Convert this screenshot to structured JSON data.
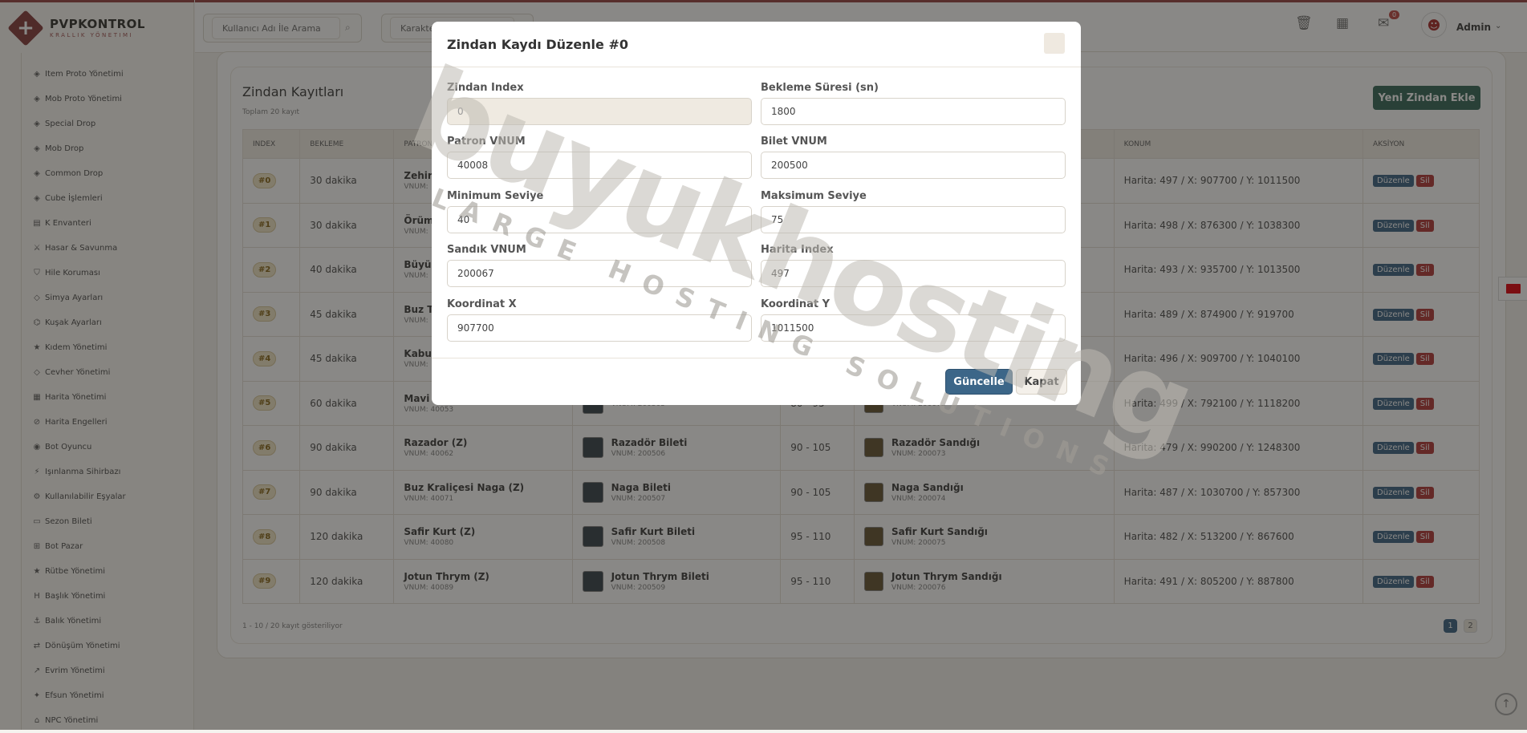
{
  "brand": {
    "title": "PVPKONTROL",
    "subtitle": "KRALLIK YÖNETIMI"
  },
  "sidebar": {
    "items": [
      {
        "icon": "box-icon",
        "glyph": "◈",
        "label": "Item Proto Yönetimi"
      },
      {
        "icon": "monster-icon",
        "glyph": "◈",
        "label": "Mob Proto Yönetimi"
      },
      {
        "icon": "gift-icon",
        "glyph": "◈",
        "label": "Special Drop"
      },
      {
        "icon": "skull-icon",
        "glyph": "◈",
        "label": "Mob Drop"
      },
      {
        "icon": "chest-icon",
        "glyph": "◈",
        "label": "Common Drop"
      },
      {
        "icon": "cube-icon",
        "glyph": "◈",
        "label": "Cube İşlemleri"
      },
      {
        "icon": "inventory-icon",
        "glyph": "▤",
        "label": "K Envanteri"
      },
      {
        "icon": "sword-icon",
        "glyph": "⚔",
        "label": "Hasar & Savunma"
      },
      {
        "icon": "shield-icon",
        "glyph": "⛉",
        "label": "Hile Koruması"
      },
      {
        "icon": "gem-icon",
        "glyph": "◇",
        "label": "Simya Ayarları"
      },
      {
        "icon": "belt-icon",
        "glyph": "⌬",
        "label": "Kuşak Ayarları"
      },
      {
        "icon": "star-icon",
        "glyph": "★",
        "label": "Kıdem Yönetimi"
      },
      {
        "icon": "diamond-icon",
        "glyph": "◇",
        "label": "Cevher Yönetimi"
      },
      {
        "icon": "map-icon",
        "glyph": "▦",
        "label": "Harita Yönetimi"
      },
      {
        "icon": "ban-icon",
        "glyph": "⊘",
        "label": "Harita Engelleri"
      },
      {
        "icon": "robot-icon",
        "glyph": "◉",
        "label": "Bot Oyuncu"
      },
      {
        "icon": "wand-icon",
        "glyph": "⚡",
        "label": "Işınlanma Sihirbazı"
      },
      {
        "icon": "gears-icon",
        "glyph": "⚙",
        "label": "Kullanılabilir Eşyalar"
      },
      {
        "icon": "ticket-icon",
        "glyph": "▭",
        "label": "Sezon Bileti"
      },
      {
        "icon": "cart-icon",
        "glyph": "⊞",
        "label": "Bot Pazar"
      },
      {
        "icon": "rank-star-icon",
        "glyph": "★",
        "label": "Rütbe Yönetimi"
      },
      {
        "icon": "heading-icon",
        "glyph": "H",
        "label": "Başlık Yönetimi"
      },
      {
        "icon": "anchor-icon",
        "glyph": "⚓",
        "label": "Balık Yönetimi"
      },
      {
        "icon": "shuffle-icon",
        "glyph": "⇄",
        "label": "Dönüşüm Yönetimi"
      },
      {
        "icon": "evolve-icon",
        "glyph": "↗",
        "label": "Evrim Yönetimi"
      },
      {
        "icon": "magic-icon",
        "glyph": "✦",
        "label": "Efsun Yönetimi"
      },
      {
        "icon": "npc-icon",
        "glyph": "⌂",
        "label": "NPC Yönetimi"
      }
    ]
  },
  "topbar": {
    "search_user_placeholder": "Kullanıcı Adı İle Arama",
    "search_char_placeholder": "Karakter",
    "notification_count": "0",
    "user": "Admin"
  },
  "page": {
    "title": "Zindan Kayıtları",
    "subtitle": "Toplam 20 kayıt",
    "new_button": "Yeni Zindan Ekle",
    "pagination_info": "1 - 10 / 20 kayıt gösteriliyor",
    "pages": [
      "1",
      "2"
    ]
  },
  "table": {
    "columns": [
      "INDEX",
      "BEKLEME",
      "PATRON",
      "BİLET",
      "SEVİYE",
      "SANDIK",
      "KONUM",
      "AKSİYON"
    ],
    "rows": [
      {
        "index": "#0",
        "wait": "30 dakika",
        "boss": "Zehir",
        "boss_vnum": "VNUM:",
        "ticket": "",
        "ticket_vnum": "",
        "level": "",
        "chest": "",
        "chest_vnum": "",
        "location": "Harita: 497 / X: 907700 / Y: 1011500"
      },
      {
        "index": "#1",
        "wait": "30 dakika",
        "boss": "Örüm",
        "boss_vnum": "VNUM:",
        "ticket": "",
        "ticket_vnum": "",
        "level": "",
        "chest": "",
        "chest_vnum": "",
        "location": "Harita: 498 / X: 876300 / Y: 1038300"
      },
      {
        "index": "#2",
        "wait": "40 dakika",
        "boss": "Büyü",
        "boss_vnum": "VNUM:",
        "ticket": "",
        "ticket_vnum": "",
        "level": "",
        "chest": "",
        "chest_vnum": "",
        "location": "Harita: 493 / X: 935700 / Y: 1013500"
      },
      {
        "index": "#3",
        "wait": "45 dakika",
        "boss": "Buz T",
        "boss_vnum": "VNUM:",
        "ticket": "",
        "ticket_vnum": "",
        "level": "",
        "chest": "",
        "chest_vnum": "",
        "location": "Harita: 489 / X: 874900 / Y: 919700"
      },
      {
        "index": "#4",
        "wait": "45 dakika",
        "boss": "Kabu",
        "boss_vnum": "VNUM:",
        "ticket": "",
        "ticket_vnum": "",
        "level": "",
        "chest": "",
        "chest_vnum": "",
        "location": "Harita: 496 / X: 909700 / Y: 1040100"
      },
      {
        "index": "#5",
        "wait": "60 dakika",
        "boss": "Mavi",
        "boss_vnum": "VNUM: 40053",
        "ticket": "",
        "ticket_vnum": "VNUM: 200505",
        "level": "80 - 95",
        "chest": "",
        "chest_vnum": "VNUM: 200072",
        "location": "Harita: 499 / X: 792100 / Y: 1118200"
      },
      {
        "index": "#6",
        "wait": "90 dakika",
        "boss": "Razador (Z)",
        "boss_vnum": "VNUM: 40062",
        "ticket": "Razadör Bileti",
        "ticket_vnum": "VNUM: 200506",
        "level": "90 - 105",
        "chest": "Razadör Sandığı",
        "chest_vnum": "VNUM: 200073",
        "location": "Harita: 479 / X: 990200 / Y: 1248300"
      },
      {
        "index": "#7",
        "wait": "90 dakika",
        "boss": "Buz Kraliçesi Naga (Z)",
        "boss_vnum": "VNUM: 40071",
        "ticket": "Naga Bileti",
        "ticket_vnum": "VNUM: 200507",
        "level": "90 - 105",
        "chest": "Naga Sandığı",
        "chest_vnum": "VNUM: 200074",
        "location": "Harita: 487 / X: 1030700 / Y: 857300"
      },
      {
        "index": "#8",
        "wait": "120 dakika",
        "boss": "Safir Kurt (Z)",
        "boss_vnum": "VNUM: 40080",
        "ticket": "Safir Kurt Bileti",
        "ticket_vnum": "VNUM: 200508",
        "level": "95 - 110",
        "chest": "Safir Kurt Sandığı",
        "chest_vnum": "VNUM: 200075",
        "location": "Harita: 482 / X: 513200 / Y: 867600"
      },
      {
        "index": "#9",
        "wait": "120 dakika",
        "boss": "Jotun Thrym (Z)",
        "boss_vnum": "VNUM: 40089",
        "ticket": "Jotun Thrym Bileti",
        "ticket_vnum": "VNUM: 200509",
        "level": "95 - 110",
        "chest": "Jotun Thrym Sandığı",
        "chest_vnum": "VNUM: 200076",
        "location": "Harita: 491 / X: 805200 / Y: 887800"
      }
    ],
    "edit_label": "Düzenle",
    "delete_label": "Sil"
  },
  "modal": {
    "title": "Zindan Kaydı Düzenle #0",
    "fields": {
      "dungeon_index": {
        "label": "Zindan Index",
        "value": "0"
      },
      "cooldown": {
        "label": "Bekleme Süresi (sn)",
        "value": "1800"
      },
      "boss_vnum": {
        "label": "Patron VNUM",
        "value": "40008"
      },
      "ticket_vnum": {
        "label": "Bilet VNUM",
        "value": "200500"
      },
      "min_level": {
        "label": "Minimum Seviye",
        "value": "40"
      },
      "max_level": {
        "label": "Maksimum Seviye",
        "value": "75"
      },
      "chest_vnum": {
        "label": "Sandık VNUM",
        "value": "200067"
      },
      "map_index": {
        "label": "Harita Index",
        "value": "497"
      },
      "coord_x": {
        "label": "Koordinat X",
        "value": "907700"
      },
      "coord_y": {
        "label": "Koordinat Y",
        "value": "1011500"
      }
    },
    "update_button": "Güncelle",
    "close_button": "Kapat"
  },
  "watermark": {
    "main": "buyukhosting",
    "sub": "LARGE HOSTING SOLUTIONS"
  }
}
